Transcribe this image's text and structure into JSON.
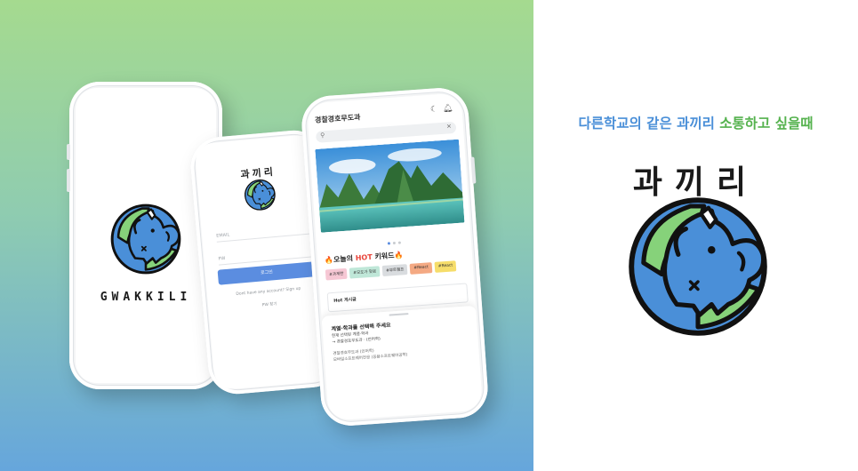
{
  "colors": {
    "brand_blue": "#4a8fd8",
    "brand_green": "#55b24e",
    "button_blue": "#5b8de0",
    "hot_red": "#e8443a"
  },
  "tagline": {
    "part1": "다른학교의 같은 과끼리 ",
    "part2": "소통하고 싶을때"
  },
  "brand": {
    "korean": "과끼리",
    "english": "GWAKKILI"
  },
  "login": {
    "title": "과끼리",
    "email_placeholder": "EMAIL",
    "pw_placeholder": "PW",
    "login_button": "로그인",
    "signup_prompt": "Dont have any account? Sign up",
    "find_pw": "PW 찾기"
  },
  "main": {
    "header_title": "경찰경호무도과",
    "icons": [
      "moon-icon",
      "bell-icon",
      "search-icon",
      "close-icon"
    ],
    "hot_prefix": "🔥오늘의 ",
    "hot_word": "HOT",
    "hot_suffix": " 키워드🔥",
    "chips": [
      {
        "label": "#과제란",
        "color": "#f6c7d4"
      },
      {
        "label": "#모도가 맞음",
        "color": "#bfe7d8"
      },
      {
        "label": "#부트캠프",
        "color": "#d9dcdf"
      },
      {
        "label": "#React",
        "color": "#f4a983"
      },
      {
        "label": "#React",
        "color": "#f6dd6a"
      }
    ],
    "hot_posts_label": "Hot 게시글",
    "sheet": {
      "title": "계열·학과를 선택해 주세요",
      "current_label": "현재 선택된 계열·학과",
      "current_value": "→ 경찰경호무도과 · (전어학)",
      "option1": "경찰경호무도과 (인어학)",
      "option2": "모바일소프트웨어전공 (응용소프트웨어공학)"
    }
  }
}
